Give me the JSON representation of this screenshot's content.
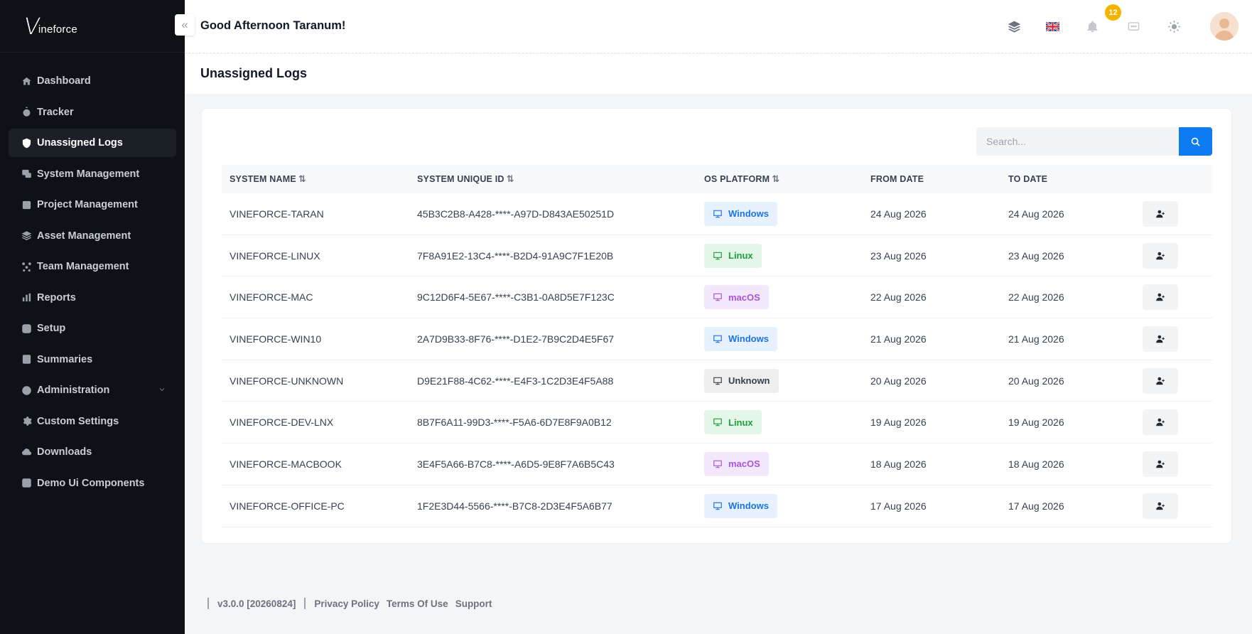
{
  "brand": {
    "mark": "V",
    "text": "ineforce"
  },
  "sidebar": {
    "items": [
      {
        "label": "Dashboard",
        "icon": "home-icon",
        "active": false
      },
      {
        "label": "Tracker",
        "icon": "stopwatch-icon",
        "active": false
      },
      {
        "label": "Unassigned Logs",
        "icon": "log-icon",
        "active": true
      },
      {
        "label": "System Management",
        "icon": "system-icon",
        "active": false
      },
      {
        "label": "Project Management",
        "icon": "project-icon",
        "active": false
      },
      {
        "label": "Asset Management",
        "icon": "layers-icon",
        "active": false
      },
      {
        "label": "Team Management",
        "icon": "team-icon",
        "active": false
      },
      {
        "label": "Reports",
        "icon": "bar-chart-icon",
        "active": false
      },
      {
        "label": "Setup",
        "icon": "setup-icon",
        "active": false
      },
      {
        "label": "Summaries",
        "icon": "summary-icon",
        "active": false
      },
      {
        "label": "Administration",
        "icon": "user-circle-icon",
        "active": false,
        "expandable": true
      },
      {
        "label": "Custom Settings",
        "icon": "gear-icon",
        "active": false
      },
      {
        "label": "Downloads",
        "icon": "cloud-download-icon",
        "active": false
      },
      {
        "label": "Demo Ui Components",
        "icon": "components-icon",
        "active": false
      }
    ]
  },
  "header": {
    "greeting": "Good Afternoon Taranum!",
    "notifications_count": "12",
    "icons": [
      "layers-icon",
      "uk-flag-icon",
      "bell-icon",
      "chat-icon",
      "sun-icon"
    ]
  },
  "page": {
    "title": "Unassigned Logs"
  },
  "search": {
    "placeholder": "Search..."
  },
  "table": {
    "columns": [
      "SYSTEM NAME",
      "SYSTEM UNIQUE ID",
      "OS PLATFORM",
      "FROM DATE",
      "TO DATE"
    ],
    "rows": [
      {
        "name": "VINEFORCE-TARAN",
        "uid": "45B3C2B8-A428-****-A97D-D843AE50251D",
        "os": "Windows",
        "from": "24 Aug 2026",
        "to": "24 Aug 2026"
      },
      {
        "name": "VINEFORCE-LINUX",
        "uid": "7F8A91E2-13C4-****-B2D4-91A9C7F1E20B",
        "os": "Linux",
        "from": "23 Aug 2026",
        "to": "23 Aug 2026"
      },
      {
        "name": "VINEFORCE-MAC",
        "uid": "9C12D6F4-5E67-****-C3B1-0A8D5E7F123C",
        "os": "macOS",
        "from": "22 Aug 2026",
        "to": "22 Aug 2026"
      },
      {
        "name": "VINEFORCE-WIN10",
        "uid": "2A7D9B33-8F76-****-D1E2-7B9C2D4E5F67",
        "os": "Windows",
        "from": "21 Aug 2026",
        "to": "21 Aug 2026"
      },
      {
        "name": "VINEFORCE-UNKNOWN",
        "uid": "D9E21F88-4C62-****-E4F3-1C2D3E4F5A88",
        "os": "Unknown",
        "from": "20 Aug 2026",
        "to": "20 Aug 2026"
      },
      {
        "name": "VINEFORCE-DEV-LNX",
        "uid": "8B7F6A11-99D3-****-F5A6-6D7E8F9A0B12",
        "os": "Linux",
        "from": "19 Aug 2026",
        "to": "19 Aug 2026"
      },
      {
        "name": "VINEFORCE-MACBOOK",
        "uid": "3E4F5A66-B7C8-****-A6D5-9E8F7A6B5C43",
        "os": "macOS",
        "from": "18 Aug 2026",
        "to": "18 Aug 2026"
      },
      {
        "name": "VINEFORCE-OFFICE-PC",
        "uid": "1F2E3D44-5566-****-B7C8-2D3E4F5A6B77",
        "os": "Windows",
        "from": "17 Aug 2026",
        "to": "17 Aug 2026"
      }
    ]
  },
  "footer": {
    "version": "v3.0.0 [20260824]",
    "links": [
      "Privacy Policy",
      "Terms Of Use",
      "Support"
    ]
  },
  "colors": {
    "sidebar_bg": "#0e1116",
    "accent": "#0d7cf2",
    "badge": "#f5b301",
    "windows": "#1b74e4",
    "linux": "#1e9e3e",
    "macos": "#a855d7"
  }
}
